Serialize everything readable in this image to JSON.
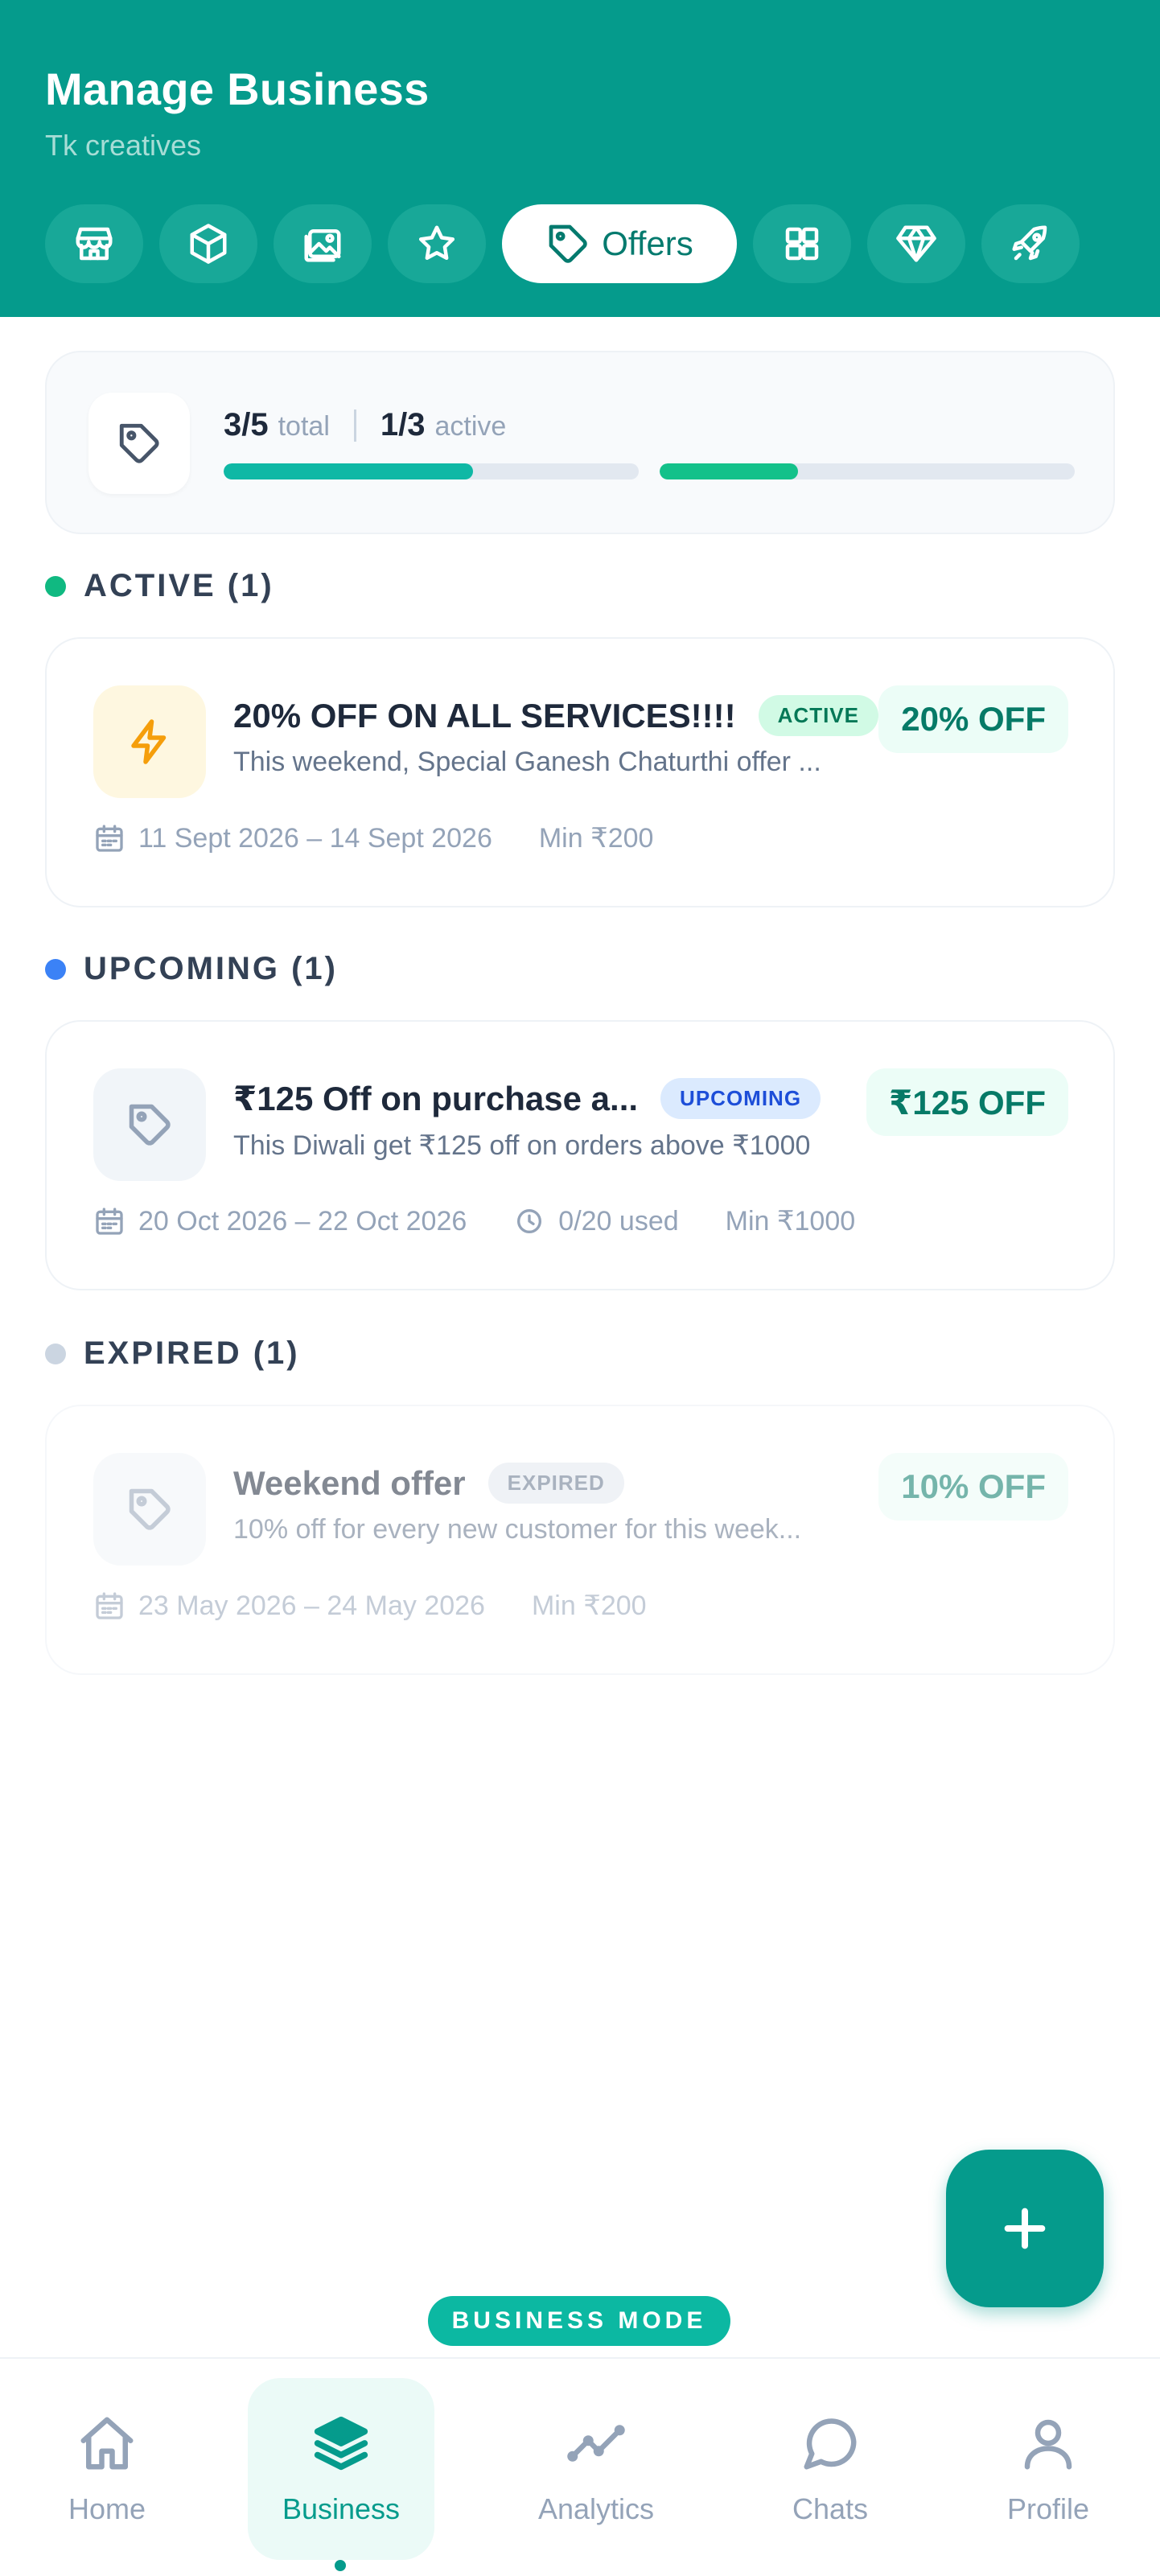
{
  "header": {
    "title": "Manage Business",
    "subtitle": "Tk creatives",
    "tabs": [
      {
        "icon": "store-icon"
      },
      {
        "icon": "box-icon"
      },
      {
        "icon": "gallery-icon"
      },
      {
        "icon": "star-icon"
      },
      {
        "icon": "tag-icon",
        "label": "Offers",
        "active": true
      },
      {
        "icon": "grid-icon"
      },
      {
        "icon": "diamond-icon"
      },
      {
        "icon": "rocket-icon"
      }
    ]
  },
  "summary": {
    "total_count": "3/5",
    "total_label": "total",
    "active_count": "1/3",
    "active_label": "active",
    "total_progress": 0.6,
    "active_progress": 0.333
  },
  "sections": {
    "active": {
      "label": "ACTIVE (1)",
      "color": "#10b981",
      "offer": {
        "title": "20% OFF ON ALL SERVICES!!!!",
        "badge": "ACTIVE",
        "description": "This weekend, Special Ganesh Chaturthi offer ...",
        "discount": "20% OFF",
        "dates": "11 Sept 2026 – 14 Sept 2026",
        "min": "Min ₹200"
      }
    },
    "upcoming": {
      "label": "UPCOMING (1)",
      "color": "#3b82f6",
      "offer": {
        "title": "₹125 Off on purchase a...",
        "badge": "UPCOMING",
        "description": "This Diwali get ₹125 off on orders above ₹1000",
        "discount": "₹125 OFF",
        "dates": "20 Oct 2026 – 22 Oct 2026",
        "usage": "0/20 used",
        "min": "Min ₹1000"
      }
    },
    "expired": {
      "label": "EXPIRED (1)",
      "color": "#cbd5e1",
      "offer": {
        "title": "Weekend offer",
        "badge": "EXPIRED",
        "description": "10% off for every new customer for this week...",
        "discount": "10% OFF",
        "dates": "23 May 2026 – 24 May 2026",
        "min": "Min ₹200"
      }
    }
  },
  "mode_pill": "BUSINESS MODE",
  "bottom_nav": [
    {
      "label": "Home",
      "icon": "home-icon"
    },
    {
      "label": "Business",
      "icon": "layers-icon",
      "active": true
    },
    {
      "label": "Analytics",
      "icon": "analytics-icon"
    },
    {
      "label": "Chats",
      "icon": "chat-icon"
    },
    {
      "label": "Profile",
      "icon": "profile-icon"
    }
  ],
  "colors": {
    "primary": "#059b8c",
    "badge_active_bg": "#d1fae5",
    "badge_active_text": "#047857",
    "badge_upcoming_bg": "#dbeafe",
    "badge_upcoming_text": "#1d4ed8",
    "badge_expired_bg": "#e2e8f0",
    "badge_expired_text": "#64748b"
  }
}
